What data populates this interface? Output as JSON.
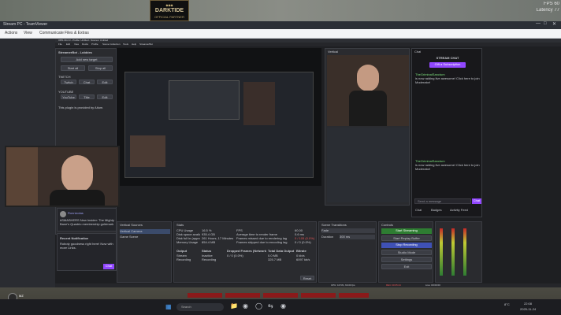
{
  "game": {
    "badge_title": "DARKTIDE",
    "badge_sub": "OFFICIAL PARTNER",
    "fps": "FPS 60",
    "latency": "Latency 77",
    "bottom_name": "MZ",
    "bottom_status": "Kraft: unknown"
  },
  "viewer": {
    "title": "Stream PC - TeamViewer",
    "menu": [
      "Actions",
      "View",
      "Communicate",
      "Files & Extras"
    ],
    "obs_title": "OBS 30.2.3 - Profile: Untitled - Scenes: Untitled",
    "obs_menu": [
      "File",
      "Edit",
      "View",
      "Docks",
      "Profile",
      "Scene Collection",
      "Tools",
      "Help",
      "StreamerBot"
    ]
  },
  "left_panel": {
    "title": "StreamerBot - Lobbies",
    "add_label": "Add new target",
    "btn_start": "Start all",
    "btn_stop": "Stop all",
    "twitch": "TWITCH",
    "youtube": "YOUTUBE",
    "t_row": [
      "Twitch",
      "Chat",
      "Edit"
    ],
    "y_row": [
      "YouTube",
      "Title",
      "Edit"
    ],
    "note": "This plugin is provided by Aitum."
  },
  "chat": {
    "title": "Chat",
    "header": "STREAM CHAT",
    "sub_btn": "Gift a Subscription",
    "msg1_user": "TheGriminalSanctum",
    "msg1_text": "is now raiding live awesome! Click here to join Moderator!",
    "msg2_user": "TheGriminalSanctum",
    "msg2_text": "is now raiding live awesome! Click here to join Moderator!",
    "input_placeholder": "Send a message",
    "chat_btn": "Chat",
    "tabs": [
      "Chat",
      "Badges",
      "Activity Feed"
    ]
  },
  "vertical": {
    "title": "Vertical"
  },
  "sources": {
    "title": "Vertical Sources",
    "items": [
      "Vertical Camera",
      "Game Scene"
    ]
  },
  "stats": {
    "title": "Stats",
    "rows": [
      [
        "CPU Usage",
        "16.5 %",
        "FPS",
        "60.00"
      ],
      [
        "Disk space available",
        "935.4 GB",
        "Average time to render frame",
        "0.6 ms"
      ],
      [
        "Disk full in (approx.)",
        "261 Hours, 17 Minutes",
        "Frames missed due to rendering lag",
        "0 / 105 (0.0%)"
      ],
      [
        "Memory Usage",
        "854.4 MB",
        "Frames skipped due to encoding lag",
        "0 / 0 (0.0%)"
      ]
    ],
    "out_headers": [
      "Output",
      "Status",
      "Dropped Frames (Network)",
      "Total Data Output",
      "Bitrate"
    ],
    "out_rows": [
      [
        "Stream",
        "Inactive",
        "0 / 0 (0.0%)",
        "0.0 MB",
        "0 kb/s"
      ],
      [
        "Recording",
        "Recording",
        "",
        "325.7 MB",
        "6097 kb/s"
      ]
    ],
    "reset": "Reset"
  },
  "transitions": {
    "title": "Scene Transitions",
    "fade": "Fade",
    "duration_label": "Duration",
    "duration": "300 ms"
  },
  "controls": {
    "title": "Controls",
    "start_stream": "Start Streaming",
    "start_replay": "Start Replay Buffer",
    "stop_rec": "Stop Recording",
    "studio": "Studio Mode",
    "settings": "Settings",
    "exit": "Exit"
  },
  "status_bar": {
    "left": "CPU: 16.5%, 60.00 fps",
    "rec": "REC 00:05:24",
    "mid": "Live: 00:00:00"
  },
  "bottom_overlay": {
    "cam_user": "Ronnicolas",
    "cam_text": "#SMASHERS New Insider: The Mighty Bane's Quadrio membership goldmark",
    "nat_title": "Recent Notification",
    "nat_text": "Roboty goodness right here! Now with more Links.",
    "send_btn": "Chat"
  },
  "taskbar": {
    "search": "Search",
    "time": "22:08",
    "date": "2025-11-24",
    "temp": "8°C"
  }
}
